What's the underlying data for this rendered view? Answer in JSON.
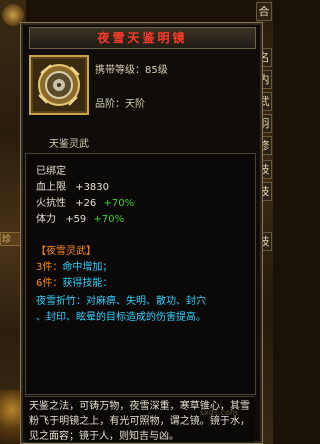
{
  "side_tabs": [
    "合",
    "名",
    "内",
    "武",
    "羽",
    "修",
    "技",
    "技",
    "技"
  ],
  "left_panel": {
    "label": "珍"
  },
  "tooltip": {
    "title": "夜雪天鉴明镜",
    "carry_level": "携带等级：85级",
    "grade": "品阶：天阶",
    "subtitle": "天鉴灵武",
    "bound": "已绑定",
    "stats": [
      {
        "name": "血上限",
        "value": "+3830",
        "pct": ""
      },
      {
        "name": "火抗性",
        "value": "+26",
        "pct": "+70%"
      },
      {
        "name": "体力",
        "value": "+59",
        "pct": "+70%"
      }
    ],
    "set_name": "【夜雪灵武】",
    "set_bonus": [
      {
        "count": "3件：",
        "text": "命中增加；"
      },
      {
        "count": "6件：",
        "text": "获得技能："
      }
    ],
    "skill_line1": "夜雪折竹：对麻痹、失明、散功、封穴",
    "skill_line2": "、封印、眩晕的目标造成的伤害提高。",
    "description": "天鉴之法，可铸万物，夜雪深重，寒草锥心，其雪粉飞于明镜之上，有光可照物，谓之镜。镜于水，见之面容；镜于人，则知吉与凶。",
    "watermark": "sxds.com"
  }
}
